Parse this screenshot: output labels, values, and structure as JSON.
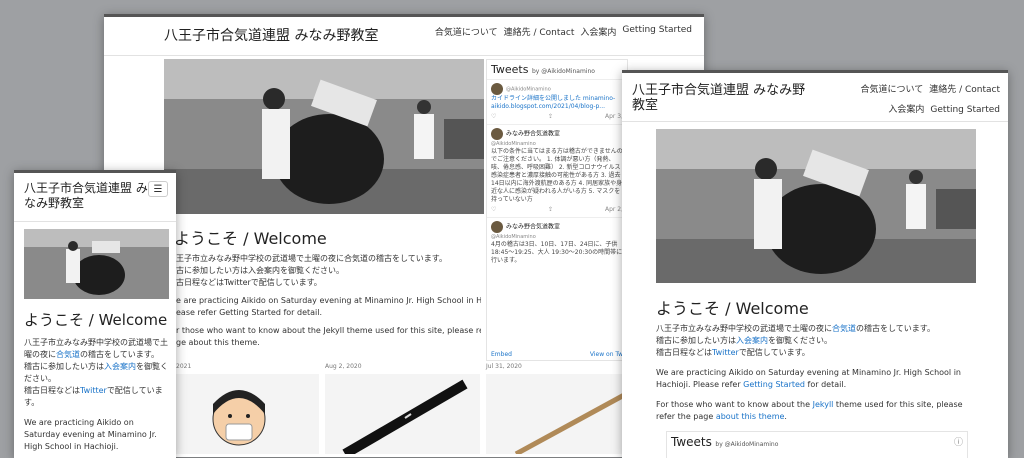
{
  "site": {
    "brand_full": "八王子市合気道連盟 みなみ野教室",
    "brand_line1_tablet": "八王子市合気道連盟 みなみ野",
    "brand_line2_tablet": "教室",
    "brand_line1_mobile": "八王子市合気道連盟 み",
    "brand_line2_mobile": "なみ野教室",
    "nav": [
      "合気道について",
      "連絡先 / Contact",
      "入会案内",
      "Getting Started"
    ],
    "menu_glyph": "☰"
  },
  "content": {
    "welcome": "ようこそ / Welcome",
    "welcome_cropped": "ようこそ / Welcome",
    "jp_line1_pre": "八王子市立みなみ野中学校の武道場で土曜の夜に",
    "jp_line1_link": "合気道",
    "jp_line1_post": "の稽古をしています。",
    "jp_line2_pre": "稽古に参加したい方は",
    "jp_line2_link": "入会案内",
    "jp_line2_post": "を御覧ください。",
    "jp_line3_pre": "稽古日程などは",
    "jp_line3_link": "Twitter",
    "jp_line3_post": "で配信しています。",
    "en_p1": "We are practicing Aikido on Saturday evening at Minamino Jr. High School in Hachioji.",
    "en_p1_pre": "Please refer ",
    "en_p1_link": "Getting Started",
    "en_p1_post": " for detail.",
    "en_p2_pre": "For those who want to know about the ",
    "en_p2_link": "Jekyll",
    "en_p2_mid": " theme used for this site, please refer the page ",
    "en_p2_link2": "about this theme",
    "en_p2_post": ".",
    "back_crop_l1": "王子市立みなみ野中学校の武道場で土曜の夜に合気道の稽古をしています。",
    "back_crop_l2": "古に参加したい方は入会案内を御覧ください。",
    "back_crop_l3": "古日程などはTwitterで配信しています。",
    "back_crop_en1": "e are practicing Aikido on Saturday evening at Minamino Jr. High School in Hachioji.",
    "back_crop_en2": "ease refer Getting Started for detail.",
    "back_crop_en3": "r those who want to know about the Jekyll theme used for this site, please refer the",
    "back_crop_en4": "ge about this theme."
  },
  "tweets": {
    "title": "Tweets",
    "by": "by @AikidoMinamino",
    "items": [
      {
        "name": "@AikidoMinamino",
        "handle": "",
        "text": "カイドライン詳細を公開しました minamino-aikido.blogspot.com/2021/04/blog-p...",
        "date": "Apr 3,"
      },
      {
        "name": "みなみ野合気道教室",
        "handle": "@AikidoMinamino",
        "text": "以下の条件に当てはまる方は稽古ができませんの でご注意ください。 1. 体調が悪い方（発熱、咳、倦怠感、呼吸困難） 2. 新型コロナウイルス感染症患者と濃厚接触の可能性がある方 3. 過去14日以内に海外渡航歴のある方 4. 同居家族や身近な人に感染が疑われる人がいる方 5. マスクを持っていない方",
        "date": "Apr 2,"
      },
      {
        "name": "みなみ野合気道教室",
        "handle": "@AikidoMinamino",
        "text": "4月の稽古は3日、10日、17日、24日に、子供 18:45〜19:25、大人 19:30〜20:30の時間帯に行います。",
        "date": ""
      }
    ],
    "embed": "Embed",
    "view_on": "View on Tw"
  },
  "cards": [
    {
      "date": "r 2, 2021"
    },
    {
      "date": "Aug 2, 2020"
    },
    {
      "date": "Jul 31, 2020"
    }
  ],
  "icons": {
    "heart": "♡",
    "share": "⇪",
    "info": "ⓘ"
  }
}
